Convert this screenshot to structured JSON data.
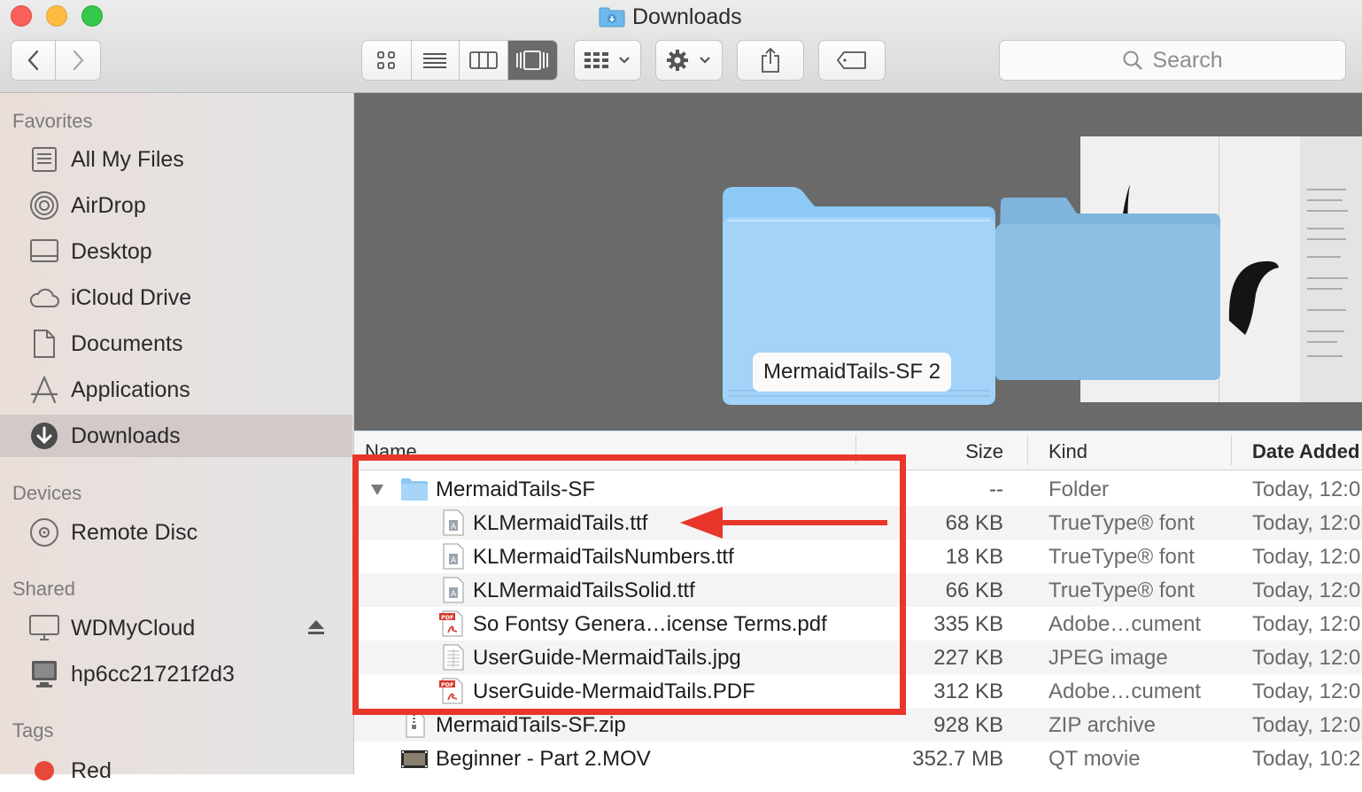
{
  "window": {
    "title": "Downloads"
  },
  "toolbar": {
    "back_icon": "chevron-left-icon",
    "forward_icon": "chevron-right-icon",
    "view_modes": [
      "icon-view",
      "list-view",
      "column-view",
      "cover-flow-view"
    ],
    "active_view": "cover-flow-view",
    "search_placeholder": "Search"
  },
  "sidebar": {
    "favorites_heading": "Favorites",
    "favorites": [
      {
        "label": "All My Files",
        "icon": "all-files-icon"
      },
      {
        "label": "AirDrop",
        "icon": "airdrop-icon"
      },
      {
        "label": "Desktop",
        "icon": "desktop-icon"
      },
      {
        "label": "iCloud Drive",
        "icon": "cloud-icon"
      },
      {
        "label": "Documents",
        "icon": "documents-icon"
      },
      {
        "label": "Applications",
        "icon": "applications-icon"
      },
      {
        "label": "Downloads",
        "icon": "downloads-icon",
        "selected": true
      }
    ],
    "devices_heading": "Devices",
    "devices": [
      {
        "label": "Remote Disc",
        "icon": "disc-icon"
      }
    ],
    "shared_heading": "Shared",
    "shared": [
      {
        "label": "WDMyCloud",
        "icon": "display-icon"
      },
      {
        "label": "hp6cc21721f2d3",
        "icon": "monitor-icon"
      }
    ],
    "tags_heading": "Tags",
    "tags": [
      {
        "label": "Red",
        "color": "#e8473b"
      }
    ]
  },
  "preview": {
    "caption": "MermaidTails-SF 2"
  },
  "columns": {
    "name": "Name",
    "size": "Size",
    "kind": "Kind",
    "date_added": "Date Added"
  },
  "files": [
    {
      "name": "MermaidTails-SF",
      "size": "--",
      "kind": "Folder",
      "date": "Today, 12:0",
      "type": "folder",
      "expanded": true,
      "level": 0
    },
    {
      "name": "KLMermaidTails.ttf",
      "size": "68 KB",
      "kind": "TrueType® font",
      "date": "Today, 12:0",
      "type": "font",
      "level": 1
    },
    {
      "name": "KLMermaidTailsNumbers.ttf",
      "size": "18 KB",
      "kind": "TrueType® font",
      "date": "Today, 12:0",
      "type": "font",
      "level": 1
    },
    {
      "name": "KLMermaidTailsSolid.ttf",
      "size": "66 KB",
      "kind": "TrueType® font",
      "date": "Today, 12:0",
      "type": "font",
      "level": 1
    },
    {
      "name": "So Fontsy Genera…icense Terms.pdf",
      "size": "335 KB",
      "kind": "Adobe…cument",
      "date": "Today, 12:0",
      "type": "pdf",
      "level": 1
    },
    {
      "name": "UserGuide-MermaidTails.jpg",
      "size": "227 KB",
      "kind": "JPEG image",
      "date": "Today, 12:0",
      "type": "jpg",
      "level": 1
    },
    {
      "name": "UserGuide-MermaidTails.PDF",
      "size": "312 KB",
      "kind": "Adobe…cument",
      "date": "Today, 12:0",
      "type": "pdf",
      "level": 1
    },
    {
      "name": "MermaidTails-SF.zip",
      "size": "928 KB",
      "kind": "ZIP archive",
      "date": "Today, 12:0",
      "type": "zip",
      "level": 0
    },
    {
      "name": "Beginner - Part 2.MOV",
      "size": "352.7 MB",
      "kind": "QT movie",
      "date": "Today, 10:2",
      "type": "mov",
      "level": 0
    }
  ],
  "annotation": {
    "highlight_color": "#e8362a"
  }
}
